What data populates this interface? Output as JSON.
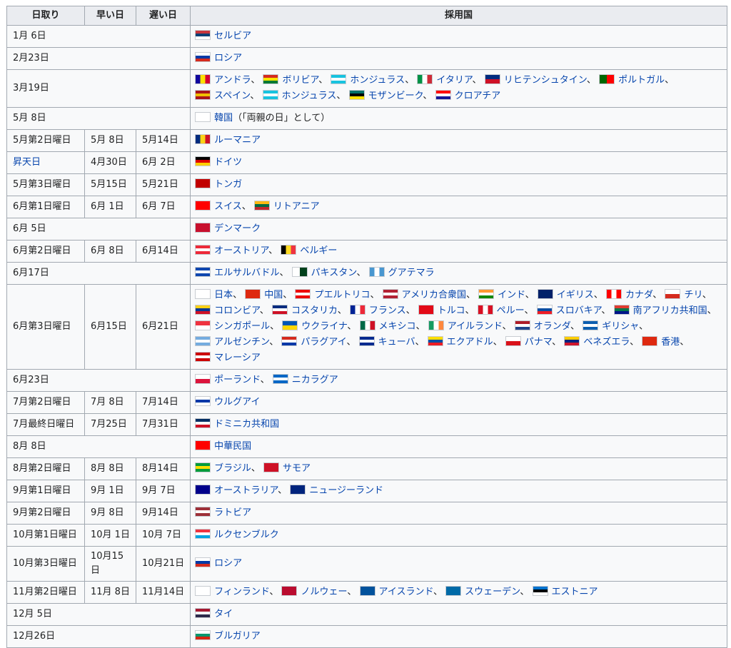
{
  "headers": [
    "日取り",
    "早い日",
    "遅い日",
    "採用国"
  ],
  "rows": [
    {
      "date": "1月 6日",
      "span": true,
      "countries": [
        {
          "name": "セルビア",
          "flag": [
            "#c6363c",
            "#0c4076",
            "#ffffff"
          ]
        }
      ]
    },
    {
      "date": "2月23日",
      "span": true,
      "countries": [
        {
          "name": "ロシア",
          "flag": [
            "#ffffff",
            "#0039a6",
            "#d52b1e"
          ]
        }
      ]
    },
    {
      "date": "3月19日",
      "span": true,
      "countries": [
        {
          "name": "アンドラ",
          "flag": [
            "#10069f",
            "#fedf00",
            "#d50032"
          ],
          "dir": "v"
        },
        {
          "name": "ボリビア",
          "flag": [
            "#d52b1e",
            "#f9e300",
            "#007934"
          ]
        },
        {
          "name": "ホンジュラス",
          "flag": [
            "#18c3df",
            "#ffffff",
            "#18c3df"
          ]
        },
        {
          "name": "イタリア",
          "flag": [
            "#009246",
            "#ffffff",
            "#ce2b37"
          ],
          "dir": "v"
        },
        {
          "name": "リヒテンシュタイン",
          "flag": [
            "#002b7f",
            "#ce1126"
          ]
        },
        {
          "name": "ポルトガル",
          "flag": [
            "#006600",
            "#ff0000"
          ],
          "dir": "v"
        },
        {
          "name": "スペイン",
          "flag": [
            "#aa151b",
            "#f1bf00",
            "#aa151b"
          ]
        },
        {
          "name": "ホンジュラス",
          "flag": [
            "#18c3df",
            "#ffffff",
            "#18c3df"
          ]
        },
        {
          "name": "モザンビーク",
          "flag": [
            "#007168",
            "#000000",
            "#fce100"
          ]
        },
        {
          "name": "クロアチア",
          "flag": [
            "#ff0000",
            "#ffffff",
            "#171796"
          ]
        }
      ],
      "wrapAfter": 7
    },
    {
      "date": "5月 8日",
      "span": true,
      "countries": [
        {
          "name": "韓国",
          "flag": [
            "#ffffff",
            "#ffffff"
          ],
          "suffix": "（「両親の日」として）"
        }
      ]
    },
    {
      "date": "5月第2日曜日",
      "early": "5月 8日",
      "late": "5月14日",
      "countries": [
        {
          "name": "ルーマニア",
          "flag": [
            "#002b7f",
            "#fcd116",
            "#ce1126"
          ],
          "dir": "v"
        }
      ]
    },
    {
      "date": "昇天日",
      "dateLink": true,
      "early": "4月30日",
      "late": "6月 2日",
      "countries": [
        {
          "name": "ドイツ",
          "flag": [
            "#000000",
            "#dd0000",
            "#ffce00"
          ]
        }
      ]
    },
    {
      "date": "5月第3日曜日",
      "early": "5月15日",
      "late": "5月21日",
      "countries": [
        {
          "name": "トンガ",
          "flag": [
            "#c10000",
            "#c10000"
          ]
        }
      ]
    },
    {
      "date": "6月第1日曜日",
      "early": "6月 1日",
      "late": "6月 7日",
      "countries": [
        {
          "name": "スイス",
          "flag": [
            "#ff0000",
            "#ff0000"
          ]
        },
        {
          "name": "リトアニア",
          "flag": [
            "#fdb913",
            "#006a44",
            "#c1272d"
          ]
        }
      ]
    },
    {
      "date": "6月 5日",
      "span": true,
      "countries": [
        {
          "name": "デンマーク",
          "flag": [
            "#c8102e",
            "#c8102e"
          ]
        }
      ]
    },
    {
      "date": "6月第2日曜日",
      "early": "6月 8日",
      "late": "6月14日",
      "countries": [
        {
          "name": "オーストリア",
          "flag": [
            "#ed2939",
            "#ffffff",
            "#ed2939"
          ]
        },
        {
          "name": "ベルギー",
          "flag": [
            "#000000",
            "#fdda24",
            "#ef3340"
          ],
          "dir": "v"
        }
      ]
    },
    {
      "date": "6月17日",
      "span": true,
      "countries": [
        {
          "name": "エルサルバドル",
          "flag": [
            "#0f47af",
            "#ffffff",
            "#0f47af"
          ]
        },
        {
          "name": "パキスタン",
          "flag": [
            "#ffffff",
            "#01411c"
          ],
          "dir": "v"
        },
        {
          "name": "グアテマラ",
          "flag": [
            "#4997d0",
            "#ffffff",
            "#4997d0"
          ],
          "dir": "v"
        }
      ]
    },
    {
      "date": "6月第3日曜日",
      "early": "6月15日",
      "late": "6月21日",
      "countries": [
        {
          "name": "日本",
          "flag": [
            "#ffffff",
            "#ffffff"
          ]
        },
        {
          "name": "中国",
          "flag": [
            "#de2910",
            "#de2910"
          ]
        },
        {
          "name": "プエルトリコ",
          "flag": [
            "#ed0000",
            "#ffffff",
            "#ed0000"
          ]
        },
        {
          "name": "アメリカ合衆国",
          "flag": [
            "#b22234",
            "#ffffff",
            "#b22234"
          ]
        },
        {
          "name": "インド",
          "flag": [
            "#ff9933",
            "#ffffff",
            "#138808"
          ]
        },
        {
          "name": "イギリス",
          "flag": [
            "#012169",
            "#012169"
          ]
        },
        {
          "name": "カナダ",
          "flag": [
            "#ff0000",
            "#ffffff",
            "#ff0000"
          ],
          "dir": "v"
        },
        {
          "name": "チリ",
          "flag": [
            "#ffffff",
            "#d52b1e"
          ]
        },
        {
          "name": "コロンビア",
          "flag": [
            "#fcd116",
            "#003893",
            "#ce1126"
          ]
        },
        {
          "name": "コスタリカ",
          "flag": [
            "#002b7f",
            "#ffffff",
            "#ce1126"
          ]
        },
        {
          "name": "フランス",
          "flag": [
            "#002395",
            "#ffffff",
            "#ed2939"
          ],
          "dir": "v"
        },
        {
          "name": "トルコ",
          "flag": [
            "#e30a17",
            "#e30a17"
          ]
        },
        {
          "name": "ペルー",
          "flag": [
            "#d91023",
            "#ffffff",
            "#d91023"
          ],
          "dir": "v"
        },
        {
          "name": "スロバキア",
          "flag": [
            "#ffffff",
            "#0b4ea2",
            "#ee1c25"
          ]
        },
        {
          "name": "南アフリカ共和国",
          "flag": [
            "#e03c31",
            "#007749",
            "#001489"
          ]
        },
        {
          "name": "シンガポール",
          "flag": [
            "#ef3340",
            "#ffffff"
          ]
        },
        {
          "name": "ウクライナ",
          "flag": [
            "#0057b7",
            "#ffd700"
          ]
        },
        {
          "name": "メキシコ",
          "flag": [
            "#006847",
            "#ffffff",
            "#ce1126"
          ],
          "dir": "v"
        },
        {
          "name": "アイルランド",
          "flag": [
            "#169b62",
            "#ffffff",
            "#ff883e"
          ],
          "dir": "v"
        },
        {
          "name": "オランダ",
          "flag": [
            "#ae1c28",
            "#ffffff",
            "#21468b"
          ]
        },
        {
          "name": "ギリシャ",
          "flag": [
            "#0d5eaf",
            "#ffffff",
            "#0d5eaf"
          ]
        },
        {
          "name": "アルゼンチン",
          "flag": [
            "#74acdf",
            "#ffffff",
            "#74acdf"
          ]
        },
        {
          "name": "パラグアイ",
          "flag": [
            "#d52b1e",
            "#ffffff",
            "#0038a8"
          ]
        },
        {
          "name": "キューバ",
          "flag": [
            "#002a8f",
            "#ffffff",
            "#002a8f"
          ]
        },
        {
          "name": "エクアドル",
          "flag": [
            "#ffdd00",
            "#034ea2",
            "#ed1c24"
          ]
        },
        {
          "name": "パナマ",
          "flag": [
            "#ffffff",
            "#da121a"
          ]
        },
        {
          "name": "ベネズエラ",
          "flag": [
            "#ffcc00",
            "#00247d",
            "#cf142b"
          ]
        },
        {
          "name": "香港",
          "flag": [
            "#de2910",
            "#de2910"
          ]
        },
        {
          "name": "マレーシア",
          "flag": [
            "#cc0001",
            "#ffffff",
            "#cc0001"
          ]
        }
      ]
    },
    {
      "date": "6月23日",
      "span": true,
      "countries": [
        {
          "name": "ポーランド",
          "flag": [
            "#ffffff",
            "#dc143c"
          ]
        },
        {
          "name": "ニカラグア",
          "flag": [
            "#0067c6",
            "#ffffff",
            "#0067c6"
          ]
        }
      ]
    },
    {
      "date": "7月第2日曜日",
      "early": "7月 8日",
      "late": "7月14日",
      "countries": [
        {
          "name": "ウルグアイ",
          "flag": [
            "#ffffff",
            "#0038a8",
            "#ffffff"
          ]
        }
      ]
    },
    {
      "date": "7月最終日曜日",
      "early": "7月25日",
      "late": "7月31日",
      "countries": [
        {
          "name": "ドミニカ共和国",
          "flag": [
            "#002d62",
            "#ffffff",
            "#ce1126"
          ]
        }
      ]
    },
    {
      "date": "8月 8日",
      "span": true,
      "countries": [
        {
          "name": "中華民国",
          "flag": [
            "#fe0000",
            "#fe0000"
          ]
        }
      ]
    },
    {
      "date": "8月第2日曜日",
      "early": "8月 8日",
      "late": "8月14日",
      "countries": [
        {
          "name": "ブラジル",
          "flag": [
            "#009c3b",
            "#ffdf00",
            "#009c3b"
          ]
        },
        {
          "name": "サモア",
          "flag": [
            "#ce1126",
            "#ce1126"
          ]
        }
      ]
    },
    {
      "date": "9月第1日曜日",
      "early": "9月 1日",
      "late": "9月 7日",
      "countries": [
        {
          "name": "オーストラリア",
          "flag": [
            "#00008b",
            "#00008b"
          ]
        },
        {
          "name": "ニュージーランド",
          "flag": [
            "#00247d",
            "#00247d"
          ]
        }
      ]
    },
    {
      "date": "9月第2日曜日",
      "early": "9月 8日",
      "late": "9月14日",
      "countries": [
        {
          "name": "ラトビア",
          "flag": [
            "#9e3039",
            "#ffffff",
            "#9e3039"
          ]
        }
      ]
    },
    {
      "date": "10月第1日曜日",
      "early": "10月 1日",
      "late": "10月 7日",
      "countries": [
        {
          "name": "ルクセンブルク",
          "flag": [
            "#ef3340",
            "#ffffff",
            "#00a3e0"
          ]
        }
      ]
    },
    {
      "date": "10月第3日曜日",
      "early": "10月15日",
      "late": "10月21日",
      "countries": [
        {
          "name": "ロシア",
          "flag": [
            "#ffffff",
            "#0039a6",
            "#d52b1e"
          ]
        }
      ]
    },
    {
      "date": "11月第2日曜日",
      "early": "11月 8日",
      "late": "11月14日",
      "countries": [
        {
          "name": "フィンランド",
          "flag": [
            "#ffffff",
            "#ffffff"
          ]
        },
        {
          "name": "ノルウェー",
          "flag": [
            "#ba0c2f",
            "#ba0c2f"
          ]
        },
        {
          "name": "アイスランド",
          "flag": [
            "#02529c",
            "#02529c"
          ]
        },
        {
          "name": "スウェーデン",
          "flag": [
            "#006aa7",
            "#006aa7"
          ]
        },
        {
          "name": "エストニア",
          "flag": [
            "#0072ce",
            "#000000",
            "#ffffff"
          ]
        }
      ]
    },
    {
      "date": "12月 5日",
      "span": true,
      "countries": [
        {
          "name": "タイ",
          "flag": [
            "#a51931",
            "#f4f5f8",
            "#2d2a4a"
          ]
        }
      ]
    },
    {
      "date": "12月26日",
      "span": true,
      "countries": [
        {
          "name": "ブルガリア",
          "flag": [
            "#ffffff",
            "#00966e",
            "#d62612"
          ]
        }
      ]
    }
  ],
  "separator": "、"
}
